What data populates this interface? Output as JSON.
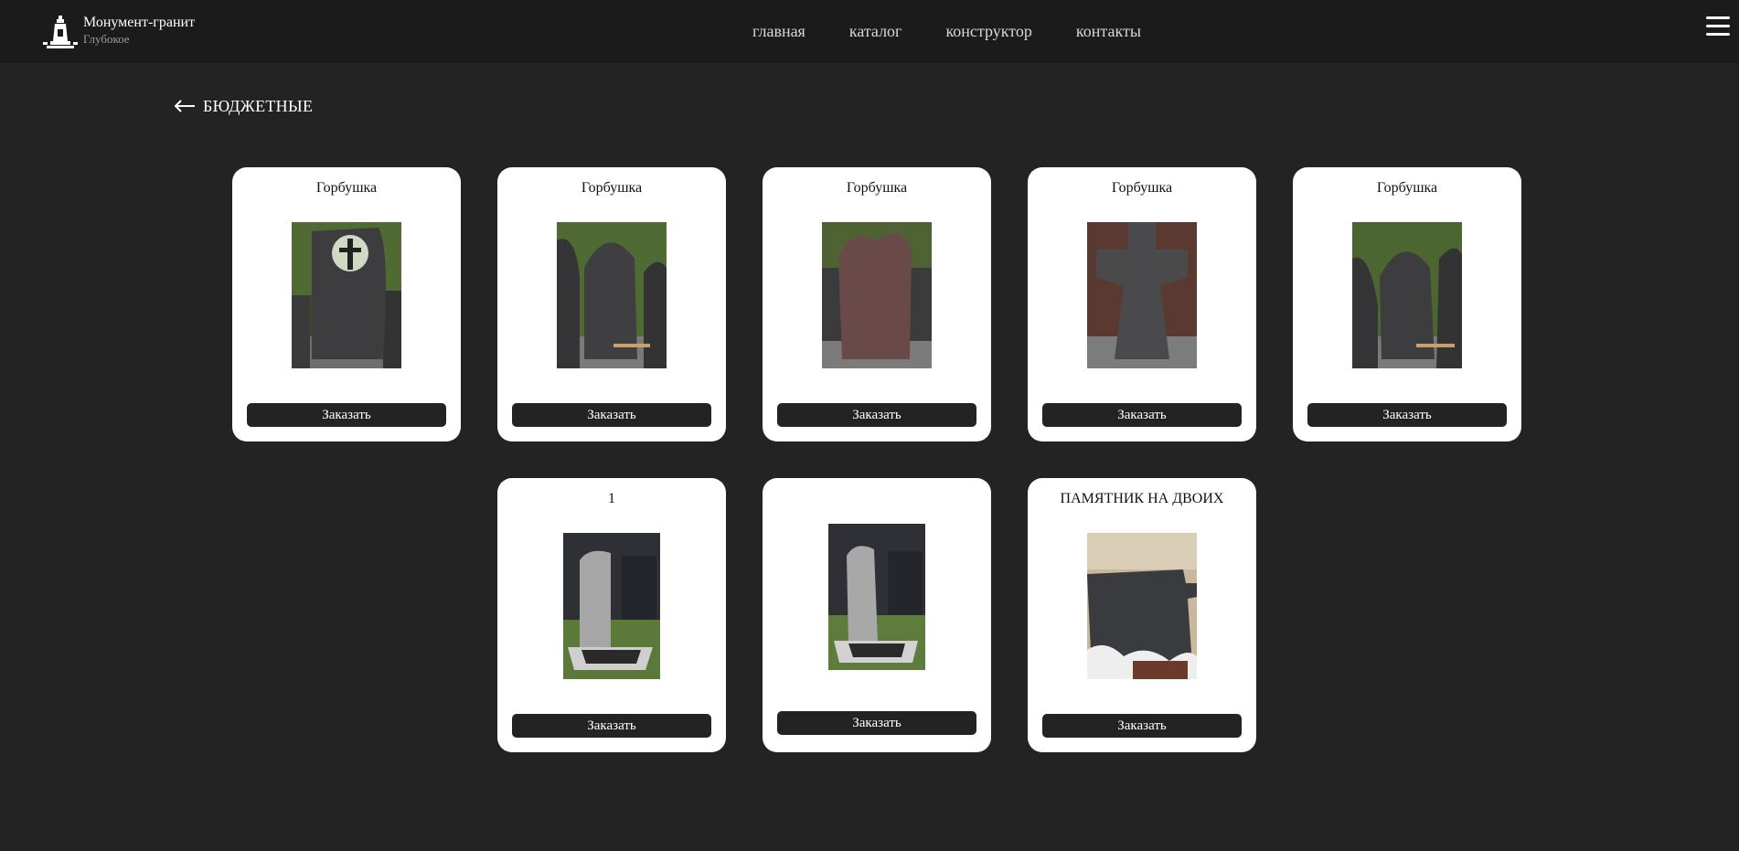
{
  "brand": {
    "title": "Монумент-гранит",
    "subtitle": "Глубокое",
    "logo_icon": "monument-logo-icon"
  },
  "nav": {
    "items": [
      "главная",
      "каталог",
      "конструктор",
      "контакты"
    ]
  },
  "menu_icon": "hamburger-menu-icon",
  "back": {
    "icon": "arrow-left-icon",
    "label": "БЮДЖЕТНЫЕ"
  },
  "products": [
    {
      "title": "Горбушка",
      "button": "Заказать",
      "photo": "black-granite-headstone-cross-cutout-4"
    },
    {
      "title": "Горбушка",
      "button": "Заказать",
      "photo": "black-granite-rounded-headstone-5"
    },
    {
      "title": "Горбушка",
      "button": "Заказать",
      "photo": "red-granite-headstone"
    },
    {
      "title": "Горбушка",
      "button": "Заказать",
      "photo": "black-granite-cross-headstone-12"
    },
    {
      "title": "Горбушка",
      "button": "Заказать",
      "photo": "black-granite-rounded-headstone-6"
    },
    {
      "title": "1",
      "button": "Заказать",
      "photo": "grey-granite-headstone-with-curb"
    },
    {
      "title": "",
      "button": "Заказать",
      "photo": "grey-granite-headstone-with-curb-2"
    },
    {
      "title": "ПАМЯТНИК НА ДВОИХ",
      "button": "Заказать",
      "photo": "double-black-granite-headstone-10"
    }
  ],
  "colors": {
    "page_bg": "#232323",
    "header_bg": "#1b1b1b",
    "card_bg": "#ffffff",
    "button_bg": "#232323"
  }
}
